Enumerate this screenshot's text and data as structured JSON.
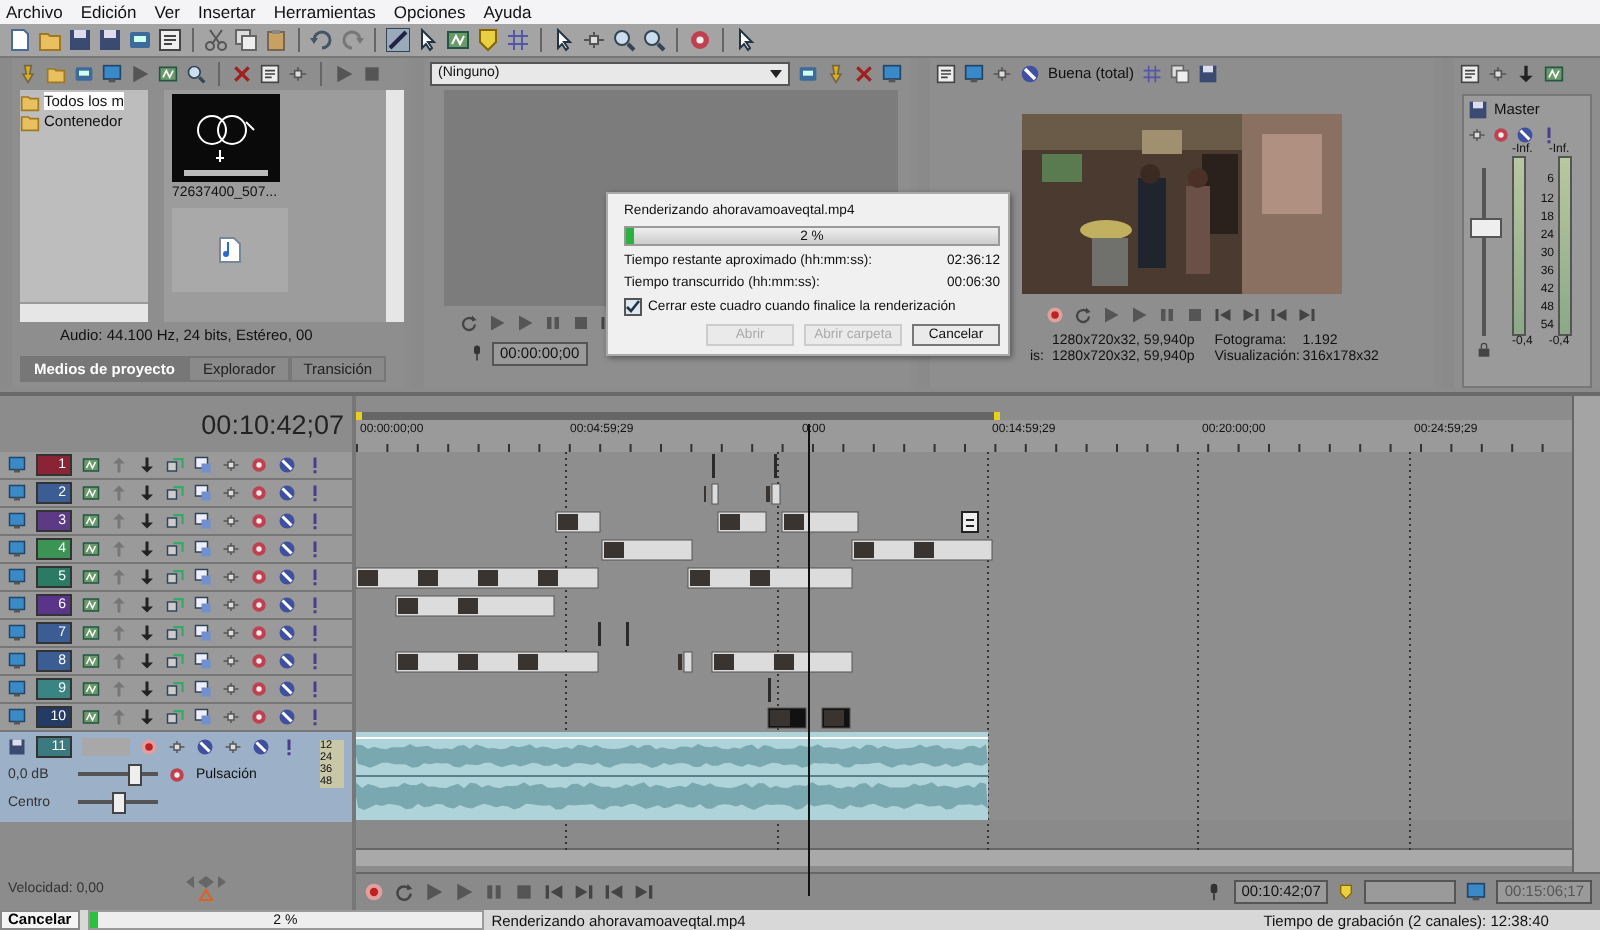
{
  "menu": [
    "Archivo",
    "Edición",
    "Ver",
    "Insertar",
    "Herramientas",
    "Opciones",
    "Ayuda"
  ],
  "project_media": {
    "tree": [
      {
        "label": "Todos los m",
        "selected": true
      },
      {
        "label": "Contenedor",
        "selected": false
      }
    ],
    "thumbnails": [
      {
        "caption": "72637400_507...",
        "kind": "picture"
      },
      {
        "kind": "audio"
      }
    ],
    "info": "Audio: 44.100 Hz, 24 bits, Estéreo, 00",
    "tabs": [
      {
        "label": "Medios de proyecto",
        "selected": true
      },
      {
        "label": "Explorador",
        "selected": false
      },
      {
        "label": "Transición",
        "selected": false
      }
    ]
  },
  "trimmer": {
    "dropdown": "(Ninguno)",
    "timecode": "00:00:00;00"
  },
  "preview": {
    "quality": "Buena (total)",
    "info": [
      {
        "value": "1280x720x32, 59,940p"
      },
      {
        "label": "is:",
        "value": "1280x720x32, 59,940p"
      }
    ],
    "stats": [
      {
        "label": "Fotograma:",
        "value": "1.192"
      },
      {
        "label": "Visualización:",
        "value": "316x178x32"
      }
    ]
  },
  "mixer": {
    "title": "Master",
    "peaks": [
      "-Inf.",
      "-Inf."
    ],
    "scale": [
      "6",
      "12",
      "18",
      "24",
      "30",
      "36",
      "42",
      "48",
      "54"
    ],
    "readings": [
      "-0,4",
      "-0,4"
    ]
  },
  "timeline": {
    "time": "00:10:42;07",
    "ruler": [
      "00:00:00;00",
      "00:04:59;29",
      "0:00",
      "00:14:59;29",
      "00:20:00;00",
      "00:24:59;29"
    ]
  },
  "tracks": [
    {
      "number": "1",
      "color": "#8a2434"
    },
    {
      "number": "2",
      "color": "#3c5c94"
    },
    {
      "number": "3",
      "color": "#5c3a84"
    },
    {
      "number": "4",
      "color": "#3c9454"
    },
    {
      "number": "5",
      "color": "#2a7a64"
    },
    {
      "number": "6",
      "color": "#5a3488"
    },
    {
      "number": "7",
      "color": "#3c5c94"
    },
    {
      "number": "8",
      "color": "#3c5c94"
    },
    {
      "number": "9",
      "color": "#3a8484"
    },
    {
      "number": "10",
      "color": "#243c64"
    }
  ],
  "audio_track": {
    "number": "11",
    "volume": {
      "label": "0,0 dB",
      "level": 0.7
    },
    "mode": "Pulsación",
    "pan": {
      "label": "Centro",
      "level": 0.5
    },
    "meter": [
      "12",
      "24",
      "36",
      "48"
    ]
  },
  "speed": "Velocidad: 0,00",
  "transport": {
    "timecode": "00:10:42;07",
    "end": "00:15:06;17"
  },
  "status": {
    "cancel": "Cancelar",
    "progress": "2 %",
    "level": 0.02,
    "file": "Renderizando ahoravamoaveqtal.mp4",
    "record_time": "Tiempo de grabación (2 canales): 12:38:40"
  },
  "dialog": {
    "title": "Renderizando ahoravamoaveqtal.mp4",
    "progress": "2 %",
    "level": 0.02,
    "rows": [
      {
        "label": "Tiempo restante aproximado (hh:mm:ss):",
        "value": "02:36:12"
      },
      {
        "label": "Tiempo transcurrido (hh:mm:ss):",
        "value": "00:06:30"
      }
    ],
    "close_when_done": {
      "label": "Cerrar este cuadro cuando finalice la renderización",
      "checked": true
    },
    "buttons": [
      {
        "label": "Abrir",
        "disabled": true
      },
      {
        "label": "Abrir carpeta",
        "disabled": true
      },
      {
        "label": "Cancelar",
        "disabled": false
      }
    ]
  }
}
